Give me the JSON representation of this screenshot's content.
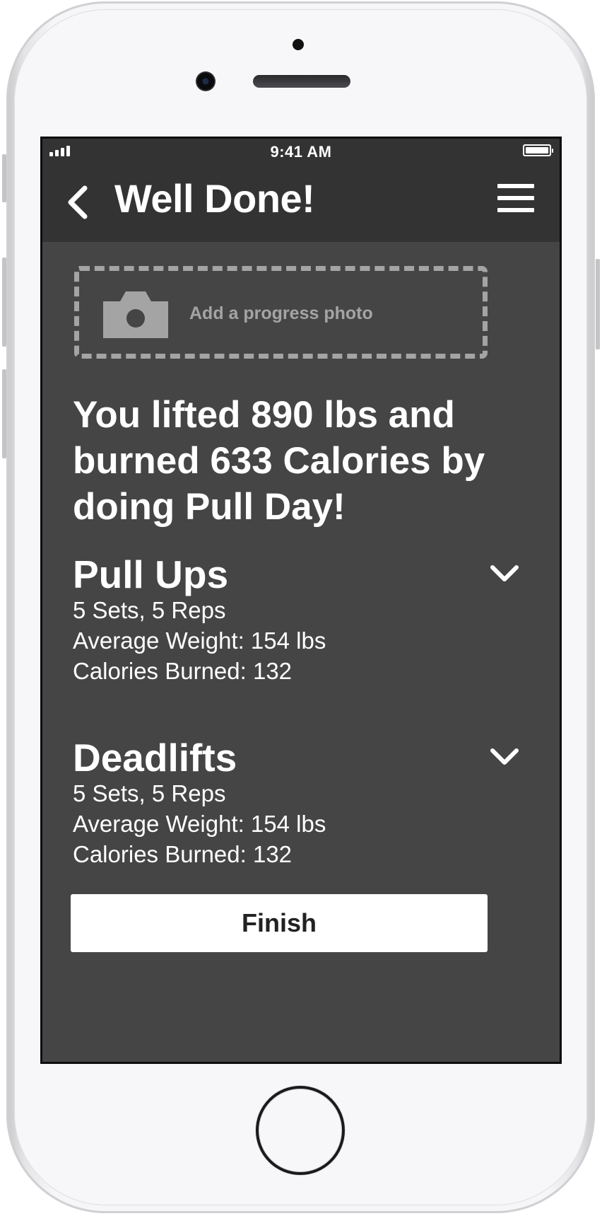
{
  "status_bar": {
    "time": "9:41 AM"
  },
  "header": {
    "title": "Well Done!",
    "back_icon": "chevron-left-icon",
    "menu_icon": "hamburger-menu-icon"
  },
  "photo_upload": {
    "label": "Add a progress photo",
    "icon": "camera-icon"
  },
  "summary": "You lifted 890 lbs and burned 633 Calories by doing Pull Day!",
  "exercises": [
    {
      "name": "Pull Ups",
      "sets": "5 Sets, 5 Reps",
      "weight": "Average Weight: 154 lbs",
      "calories": "Calories Burned: 132"
    },
    {
      "name": "Deadlifts",
      "sets": "5 Sets, 5 Reps",
      "weight": "Average Weight: 154 lbs",
      "calories": "Calories Burned: 132"
    }
  ],
  "finish_button": {
    "label": "Finish"
  },
  "colors": {
    "screen_bg": "#454545",
    "header_bg": "#333333",
    "text": "#ffffff",
    "muted": "#a4a4a4",
    "button_bg": "#ffffff"
  }
}
